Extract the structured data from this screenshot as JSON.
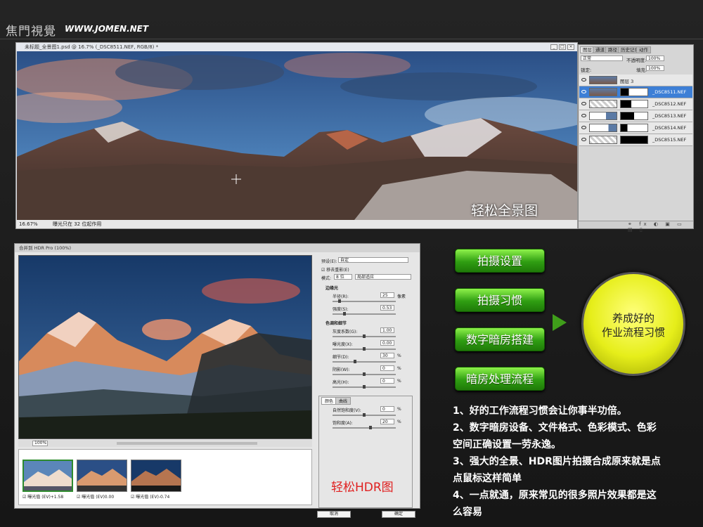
{
  "brand": {
    "name_cn": "焦門視覺",
    "site": "WWW.JOMEN.NET"
  },
  "ps_window": {
    "title": "未标题_全景图1.psd @ 16.7% (_DSC8511.NEF, RGB/8) *",
    "zoom": "16.67%",
    "status": "曝光只在 32 位起作用",
    "caption": "轻松全景图"
  },
  "layers_panel": {
    "tabs": [
      "图层",
      "通道",
      "路径",
      "历史记录",
      "动作"
    ],
    "blend_mode": "正常",
    "opacity_label": "不透明度:",
    "opacity_value": "100%",
    "lock_label": "锁定:",
    "fill_label": "填充:",
    "fill_value": "100%",
    "layers": [
      {
        "name": "图层 3",
        "selected": false
      },
      {
        "name": "_DSC8511.NEF",
        "selected": true
      },
      {
        "name": "_DSC8512.NEF",
        "selected": false
      },
      {
        "name": "_DSC8513.NEF",
        "selected": false
      },
      {
        "name": "_DSC8514.NEF",
        "selected": false
      },
      {
        "name": "_DSC8515.NEF",
        "selected": false
      }
    ]
  },
  "hdr_window": {
    "title": "合并到 HDR Pro (100%)",
    "zoom": "100%",
    "caption": "轻松HDR图",
    "preset_label": "预设(E):",
    "preset_value": "自定",
    "remove_ghost": "移去重影(E)",
    "mode_label": "模式:",
    "mode_bits": "8 位",
    "mode_method": "局部适应",
    "edge_glow": "边缘光",
    "radius_label": "半径(R):",
    "radius_value": "25",
    "radius_unit": "像素",
    "strength_label": "强度(S):",
    "strength_value": "0.53",
    "tone_detail": "色调和细节",
    "gamma_label": "灰度系数(G):",
    "gamma_value": "1.00",
    "exposure_label": "曝光度(X):",
    "exposure_value": "0.00",
    "detail_label": "细节(D):",
    "detail_value": "30",
    "shadow_label": "阴影(W):",
    "shadow_value": "0",
    "highlight_label": "高光(H):",
    "highlight_value": "0",
    "pct": "%",
    "color_tab": "颜色",
    "curve_tab": "曲线",
    "vibrance_label": "自然饱和度(V):",
    "vibrance_value": "0",
    "saturation_label": "饱和度(A):",
    "saturation_value": "20",
    "cancel": "取消",
    "ok": "确定",
    "films": [
      {
        "label": "曝光值 (EV)+1.58"
      },
      {
        "label": "曝光值 (EV)0.00"
      },
      {
        "label": "曝光值 (EV)-0.74"
      }
    ]
  },
  "steps": [
    "拍摄设置",
    "拍摄习惯",
    "数字暗房搭建",
    "暗房处理流程"
  ],
  "result": {
    "line1": "养成好的",
    "line2": "作业流程习惯"
  },
  "notes": [
    "1、好的工作流程习惯会让你事半功倍。",
    "2、数字暗房设备、文件格式、色彩模式、色彩",
    "空间正确设置一劳永逸。",
    "3、强大的全景、HDR图片拍摄合成原来就是点",
    "点鼠标这样简单",
    "4、一点就通，原来常见的很多照片效果都是这",
    "么容易"
  ],
  "colors": {
    "green": "#2f9e12",
    "yellow": "#e6ee1a",
    "selected_layer": "#3d7fd6",
    "hdr_caption": "#e02020"
  }
}
